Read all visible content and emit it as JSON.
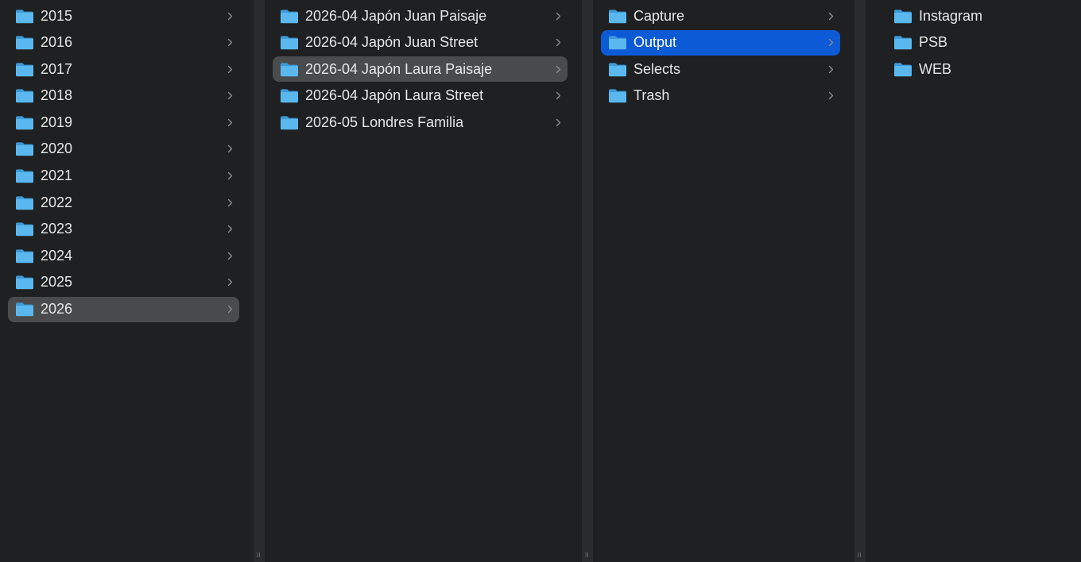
{
  "colors": {
    "background": "#1f2021",
    "divider": "#2a2b2c",
    "text": "#e6e6e6",
    "selection_gray": "#4a4b4c",
    "selection_blue": "#0c5ad6",
    "folder_body": "#5ab8ef",
    "folder_tab": "#3d9ad8"
  },
  "icons": {
    "folder": "folder-icon",
    "chevron": "chevron-right-icon",
    "resize": "column-resize-grip-icon"
  },
  "divider_grip": "ll",
  "columns": [
    {
      "id": "years",
      "items": [
        {
          "label": "2015",
          "has_children": true,
          "selected": "none"
        },
        {
          "label": "2016",
          "has_children": true,
          "selected": "none"
        },
        {
          "label": "2017",
          "has_children": true,
          "selected": "none"
        },
        {
          "label": "2018",
          "has_children": true,
          "selected": "none"
        },
        {
          "label": "2019",
          "has_children": true,
          "selected": "none"
        },
        {
          "label": "2020",
          "has_children": true,
          "selected": "none"
        },
        {
          "label": "2021",
          "has_children": true,
          "selected": "none"
        },
        {
          "label": "2022",
          "has_children": true,
          "selected": "none"
        },
        {
          "label": "2023",
          "has_children": true,
          "selected": "none"
        },
        {
          "label": "2024",
          "has_children": true,
          "selected": "none"
        },
        {
          "label": "2025",
          "has_children": true,
          "selected": "none"
        },
        {
          "label": "2026",
          "has_children": true,
          "selected": "path"
        }
      ]
    },
    {
      "id": "projects",
      "items": [
        {
          "label": "2026-04 Japón Juan Paisaje",
          "has_children": true,
          "selected": "none"
        },
        {
          "label": "2026-04 Japón Juan Street",
          "has_children": true,
          "selected": "none"
        },
        {
          "label": "2026-04 Japón Laura Paisaje",
          "has_children": true,
          "selected": "path"
        },
        {
          "label": "2026-04 Japón Laura Street",
          "has_children": true,
          "selected": "none"
        },
        {
          "label": "2026-05 Londres Familia",
          "has_children": true,
          "selected": "none"
        }
      ]
    },
    {
      "id": "subfolders",
      "items": [
        {
          "label": "Capture",
          "has_children": true,
          "selected": "none"
        },
        {
          "label": "Output",
          "has_children": true,
          "selected": "active"
        },
        {
          "label": "Selects",
          "has_children": true,
          "selected": "none"
        },
        {
          "label": "Trash",
          "has_children": true,
          "selected": "none"
        }
      ]
    },
    {
      "id": "output-contents",
      "items": [
        {
          "label": "Instagram",
          "has_children": false,
          "selected": "none"
        },
        {
          "label": "PSB",
          "has_children": false,
          "selected": "none"
        },
        {
          "label": "WEB",
          "has_children": false,
          "selected": "none"
        }
      ]
    }
  ]
}
